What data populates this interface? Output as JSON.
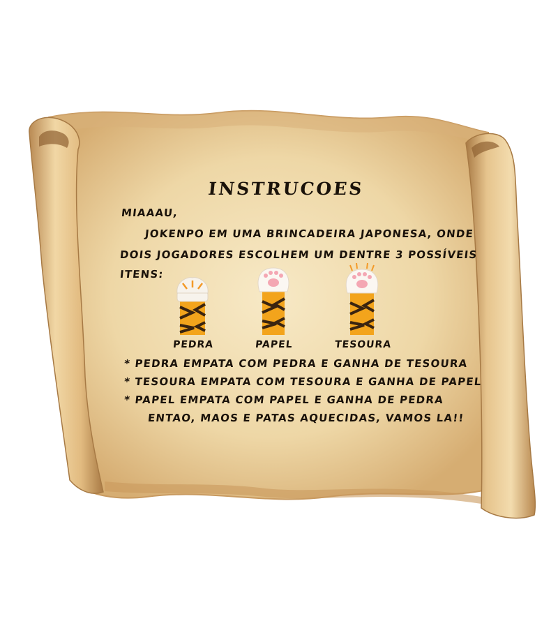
{
  "title": "INSTRUCOES",
  "greeting": "MIAAAU,",
  "intro_line1": "JOKENPO EM UMA BRINCADEIRA JAPONESA, ONDE",
  "intro_line2": "DOIS JOGADORES ESCOLHEM UM DENTRE 3 POSSÍVEIS",
  "intro_line3": "ITENS:",
  "items": [
    {
      "label": "PEDRA",
      "icon": "closed-paw-icon"
    },
    {
      "label": "PAPEL",
      "icon": "open-paw-icon"
    },
    {
      "label": "TESOURA",
      "icon": "clawed-paw-icon"
    }
  ],
  "rules": [
    "* PEDRA EMPATA COM PEDRA E GANHA DE TESOURA",
    "* TESOURA EMPATA COM TESOURA E GANHA DE PAPEL",
    "* PAPEL EMPATA COM PAPEL E GANHA DE PEDRA"
  ],
  "closing": "ENTAO, MAOS E PATAS AQUECIDAS, VAMOS LA!!",
  "colors": {
    "parchment": "#f3deb0",
    "parchment_edge": "#c99a5e",
    "fur": "#f3a41c",
    "stripe": "#3a2410",
    "pad": "#f4a7b3",
    "ink": "#1a120a"
  }
}
